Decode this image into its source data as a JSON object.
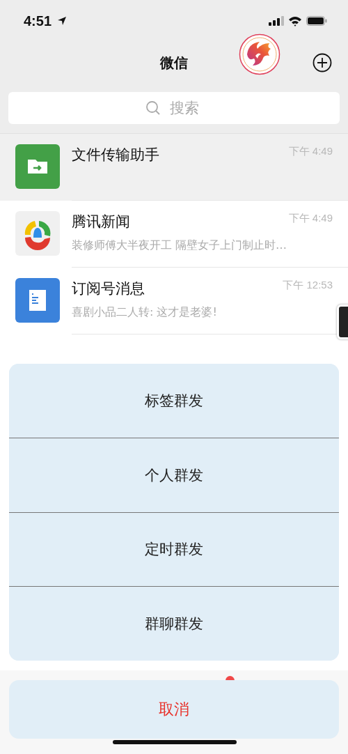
{
  "status_bar": {
    "time": "4:51"
  },
  "nav": {
    "title": "微信"
  },
  "search": {
    "placeholder": "搜索"
  },
  "chats": [
    {
      "kind": "file",
      "name": "文件传输助手",
      "time": "下午 4:49",
      "pinned": true
    },
    {
      "kind": "news",
      "name": "腾讯新闻",
      "time": "下午 4:49",
      "preview": "装修师傅大半夜开工 隔壁女子上门制止时…",
      "pinned": false
    },
    {
      "kind": "subscription",
      "name": "订阅号消息",
      "time": "下午 12:53",
      "preview": "喜剧小品二人转: 这才是老婆!",
      "pinned": false
    }
  ],
  "action_sheet": {
    "options": [
      "标签群发",
      "个人群发",
      "定时群发",
      "群聊群发"
    ],
    "cancel": "取消"
  }
}
